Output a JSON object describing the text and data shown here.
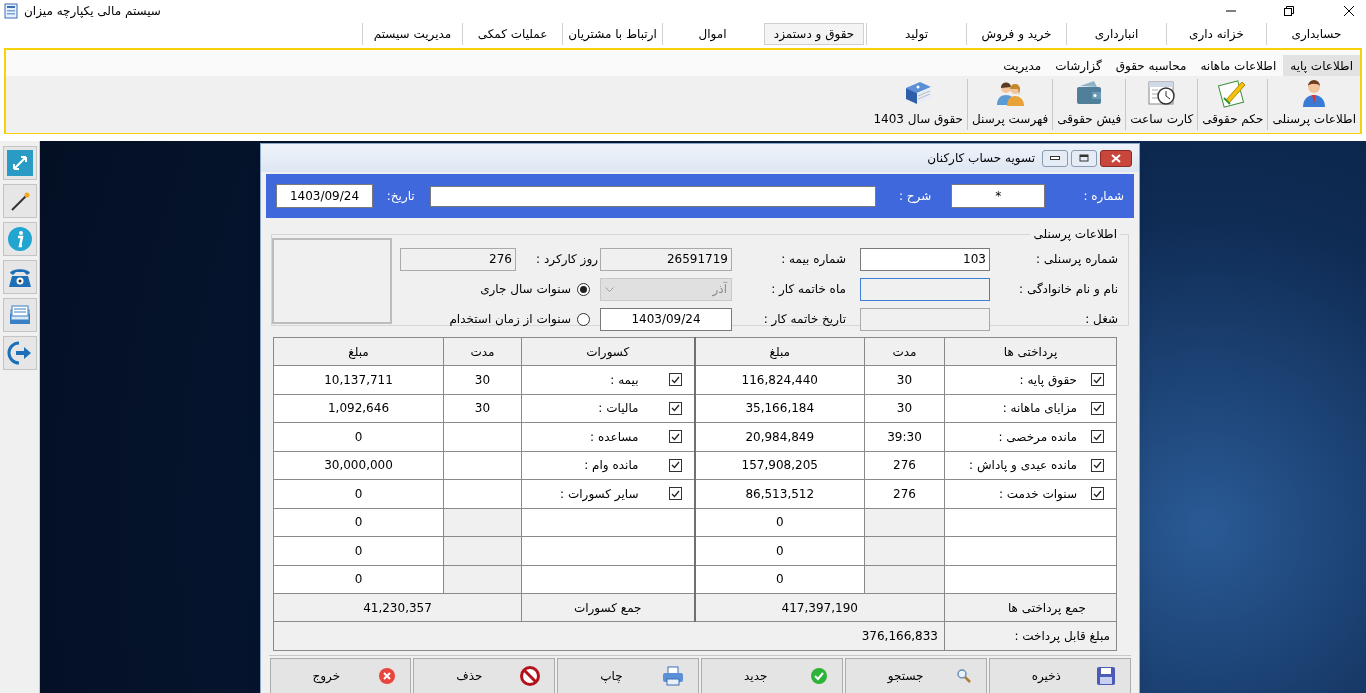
{
  "app": {
    "title": "سیستم مالی یکپارچه میزان"
  },
  "menu_tabs": [
    {
      "label": "حسابداری",
      "selected": false
    },
    {
      "label": "خزانه داری",
      "selected": false
    },
    {
      "label": "انبارداری",
      "selected": false
    },
    {
      "label": "خرید و فروش",
      "selected": false
    },
    {
      "label": "تولید",
      "selected": false
    },
    {
      "label": "حقوق و دستمزد",
      "selected": true
    },
    {
      "label": "اموال",
      "selected": false
    },
    {
      "label": "ارتباط با مشتریان",
      "selected": false
    },
    {
      "label": "عملیات کمکی",
      "selected": false
    },
    {
      "label": "مدیریت سیستم",
      "selected": false
    }
  ],
  "ribbon_tabs": [
    {
      "label": "اطلاعات پایه",
      "selected": true
    },
    {
      "label": "اطلاعات ماهانه",
      "selected": false
    },
    {
      "label": "محاسبه حقوق",
      "selected": false
    },
    {
      "label": "گزارشات",
      "selected": false
    },
    {
      "label": "مدیریت",
      "selected": false
    }
  ],
  "toolbar": [
    {
      "label": "اطلاعات پرسنلی"
    },
    {
      "label": "حکم حقوقی"
    },
    {
      "label": "کارت ساعت"
    },
    {
      "label": "فیش حقوقی"
    },
    {
      "label": "فهرست پرسنل"
    },
    {
      "label": "حقوق سال 1403"
    }
  ],
  "dialog": {
    "title": "تسویه حساب کارکنان",
    "header": {
      "number_label": "شماره :",
      "number_value": "*",
      "description_label": "شرح :",
      "date_label": "تاریخ:",
      "date_value": "1403/09/24"
    },
    "personnel": {
      "title": "اطلاعات پرسنلی",
      "personnel_number": {
        "label": "شماره پرسنلی :",
        "value": "103"
      },
      "full_name": {
        "label": "نام و نام خانوادگی :",
        "focused": true
      },
      "job": {
        "label": "شغل :"
      },
      "insurance_number": {
        "label": "شماره بیمه :",
        "value": "26591719"
      },
      "end_month": {
        "label": "ماه خاتمه کار :",
        "value": "آذر",
        "disabled": true
      },
      "end_date": {
        "label": "تاریخ خاتمه کار :",
        "value": "1403/09/24"
      },
      "work_days": {
        "label": "روز کارکرد :",
        "value": "276"
      },
      "radios": [
        {
          "label": "سنوات سال جاری",
          "selected": true
        },
        {
          "label": "سنوات از زمان استخدام",
          "selected": false
        }
      ]
    },
    "table": {
      "columns": [
        "پرداختی ها",
        "مدت",
        "مبلغ",
        "کسورات",
        "مدت",
        "مبلغ"
      ],
      "rows": [
        {
          "payment": {
            "checked": true,
            "label": "حقوق پایه :",
            "duration": "30",
            "amount": "116,824,440"
          },
          "deduction": {
            "checked": true,
            "label": "بیمه :",
            "duration": "30",
            "amount": "10,137,711"
          }
        },
        {
          "payment": {
            "checked": true,
            "label": "مزایای ماهانه :",
            "duration": "30",
            "amount": "35,166,184"
          },
          "deduction": {
            "checked": true,
            "label": "مالیات :",
            "duration": "30",
            "amount": "1,092,646"
          }
        },
        {
          "payment": {
            "checked": true,
            "label": "مانده مرخصی :",
            "duration": "39:30",
            "amount": "20,984,849"
          },
          "deduction": {
            "checked": true,
            "label": "مساعده :",
            "amount": "0"
          }
        },
        {
          "payment": {
            "checked": true,
            "label": "مانده عیدی و پاداش :",
            "duration": "276",
            "amount": "157,908,205"
          },
          "deduction": {
            "checked": true,
            "label": "مانده وام :",
            "amount": "30,000,000"
          }
        },
        {
          "payment": {
            "checked": true,
            "label": "سنوات خدمت :",
            "duration": "276",
            "amount": "86,513,512"
          },
          "deduction": {
            "checked": true,
            "label": "سایر کسورات :",
            "amount": "0"
          }
        },
        {
          "payment": {
            "amount": "0"
          },
          "deduction": {
            "amount": "0"
          }
        },
        {
          "payment": {
            "amount": "0"
          },
          "deduction": {
            "amount": "0"
          }
        },
        {
          "payment": {
            "amount": "0"
          },
          "deduction": {
            "amount": "0"
          }
        }
      ],
      "totals": {
        "payments_label": "جمع پرداختی ها",
        "payments_total": "417,397,190",
        "deductions_label": "جمع کسورات",
        "deductions_total": "41,230,357"
      },
      "payable": {
        "label": "مبلغ قابل پرداخت :",
        "value": "376,166,833"
      }
    },
    "buttons": [
      {
        "label": "ذخیره"
      },
      {
        "label": "جستجو"
      },
      {
        "label": "جدید"
      },
      {
        "label": "چاپ"
      },
      {
        "label": "حذف"
      },
      {
        "label": "خروج"
      }
    ]
  }
}
